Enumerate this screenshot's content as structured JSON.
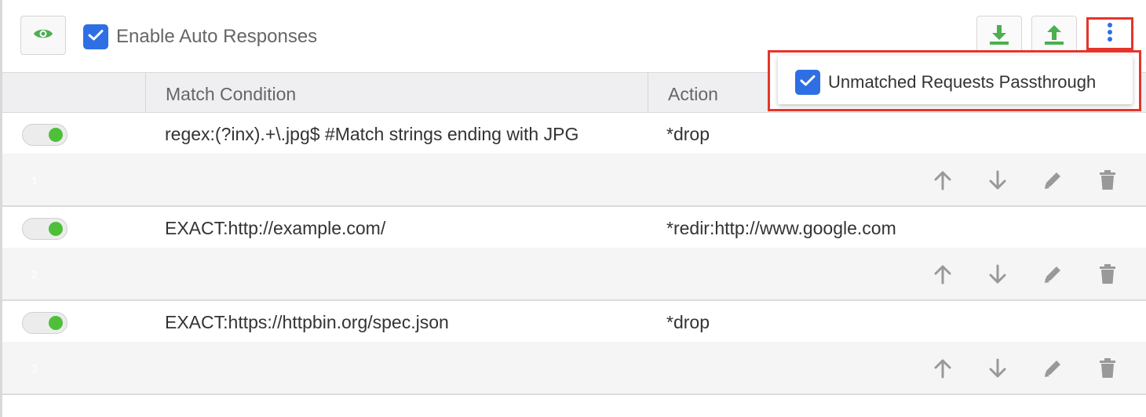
{
  "toolbar": {
    "enable_label": "Enable Auto Responses",
    "enable_checked": true
  },
  "table": {
    "headers": [
      "",
      "Match Condition",
      "Action"
    ]
  },
  "rules": [
    {
      "index": "1",
      "enabled": true,
      "condition": "regex:(?inx).+\\.jpg$ #Match strings ending with JPG",
      "action": "*drop"
    },
    {
      "index": "2",
      "enabled": true,
      "condition": "EXACT:http://example.com/",
      "action": "*redir:http://www.google.com"
    },
    {
      "index": "3",
      "enabled": true,
      "condition": "EXACT:https://httpbin.org/spec.json",
      "action": "*drop"
    }
  ],
  "dropdown": {
    "passthrough_label": "Unmatched Requests Passthrough",
    "passthrough_checked": true
  },
  "colors": {
    "accent": "#2f6fe4",
    "highlight": "#e5352b",
    "toggle_on": "#4fbf3a",
    "icon_green": "#4caf50"
  },
  "icons": [
    "eye-icon",
    "download-icon",
    "upload-icon",
    "more-vertical-icon",
    "arrow-up-icon",
    "arrow-down-icon",
    "pencil-icon",
    "trash-icon",
    "checkmark-icon"
  ]
}
